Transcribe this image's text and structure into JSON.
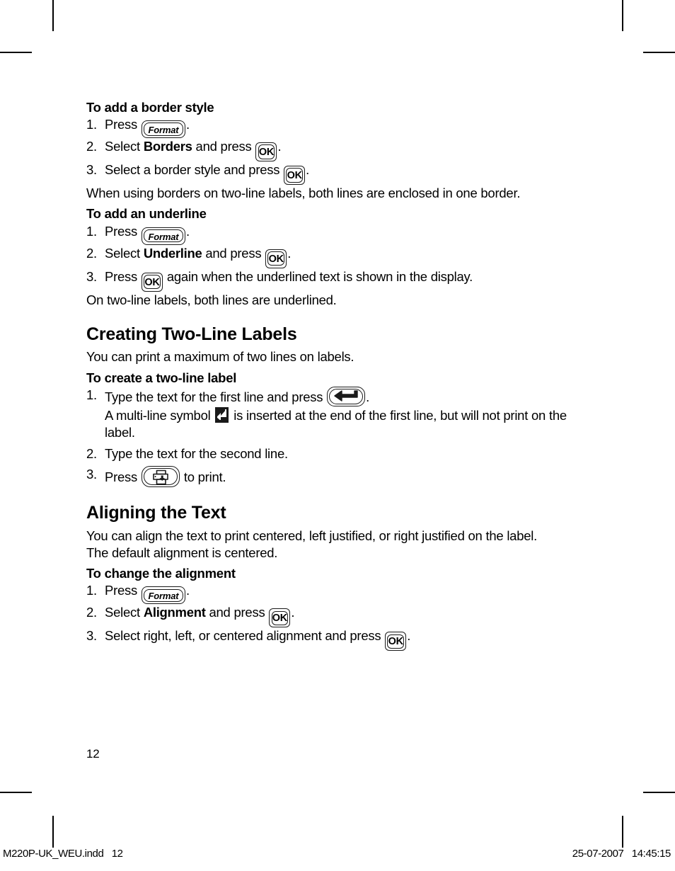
{
  "document": {
    "page_number": "12",
    "footer_left": "M220P-UK_WEU.indd   12",
    "footer_right": "25-07-2007   14:45:15"
  },
  "icons": {
    "format_key": "Format",
    "ok_key": "OK",
    "enter_key": "enter-key-icon",
    "print_key": "print-key-icon",
    "multiline_symbol": "multi-line-return-symbol"
  },
  "sections": [
    {
      "id": "border-style",
      "heading": "To add a border style",
      "steps": [
        {
          "num": "1.",
          "pre": "Press ",
          "key": "format",
          "post": "."
        },
        {
          "num": "2.",
          "pre": "Select ",
          "bold": "Borders",
          "mid": " and press ",
          "key": "ok",
          "post": "."
        },
        {
          "num": "3.",
          "pre": "Select a border style and press ",
          "key": "ok",
          "post": "."
        }
      ],
      "note": "When using borders on two-line labels, both lines are enclosed in one border."
    },
    {
      "id": "underline",
      "heading": "To add an underline",
      "steps": [
        {
          "num": "1.",
          "pre": "Press ",
          "key": "format",
          "post": "."
        },
        {
          "num": "2.",
          "pre": "Select ",
          "bold": "Underline",
          "mid": " and press ",
          "key": "ok",
          "post": "."
        },
        {
          "num": "3.",
          "pre": "Press ",
          "key": "ok",
          "post": " again when the underlined text is shown in the display."
        }
      ],
      "note": "On two-line labels, both lines are underlined."
    }
  ],
  "two_line": {
    "title": "Creating Two-Line Labels",
    "intro": "You can print a maximum of two lines on labels.",
    "subheading": "To create a two-line label",
    "step1_num": "1.",
    "step1_pre": "Type the text for the first line and press ",
    "step1_post": ".",
    "step1_sub_pre": "A multi-line symbol ",
    "step1_sub_post": " is inserted at the end of the first line, but will not print on the label.",
    "step2_num": "2.",
    "step2_text": "Type the text for the second line.",
    "step3_num": "3.",
    "step3_pre": "Press ",
    "step3_post": " to print."
  },
  "aligning": {
    "title": "Aligning the Text",
    "intro_line1": "You can align the text to print centered, left justified, or right justified on the label.",
    "intro_line2": "The default alignment is centered.",
    "subheading": "To change the alignment",
    "step1_num": "1.",
    "step1_pre": "Press ",
    "step1_post": ".",
    "step2_num": "2.",
    "step2_pre": "Select ",
    "step2_bold": "Alignment",
    "step2_mid": " and press ",
    "step2_post": ".",
    "step3_num": "3.",
    "step3_pre": "Select right, left, or centered alignment and press ",
    "step3_post": "."
  }
}
